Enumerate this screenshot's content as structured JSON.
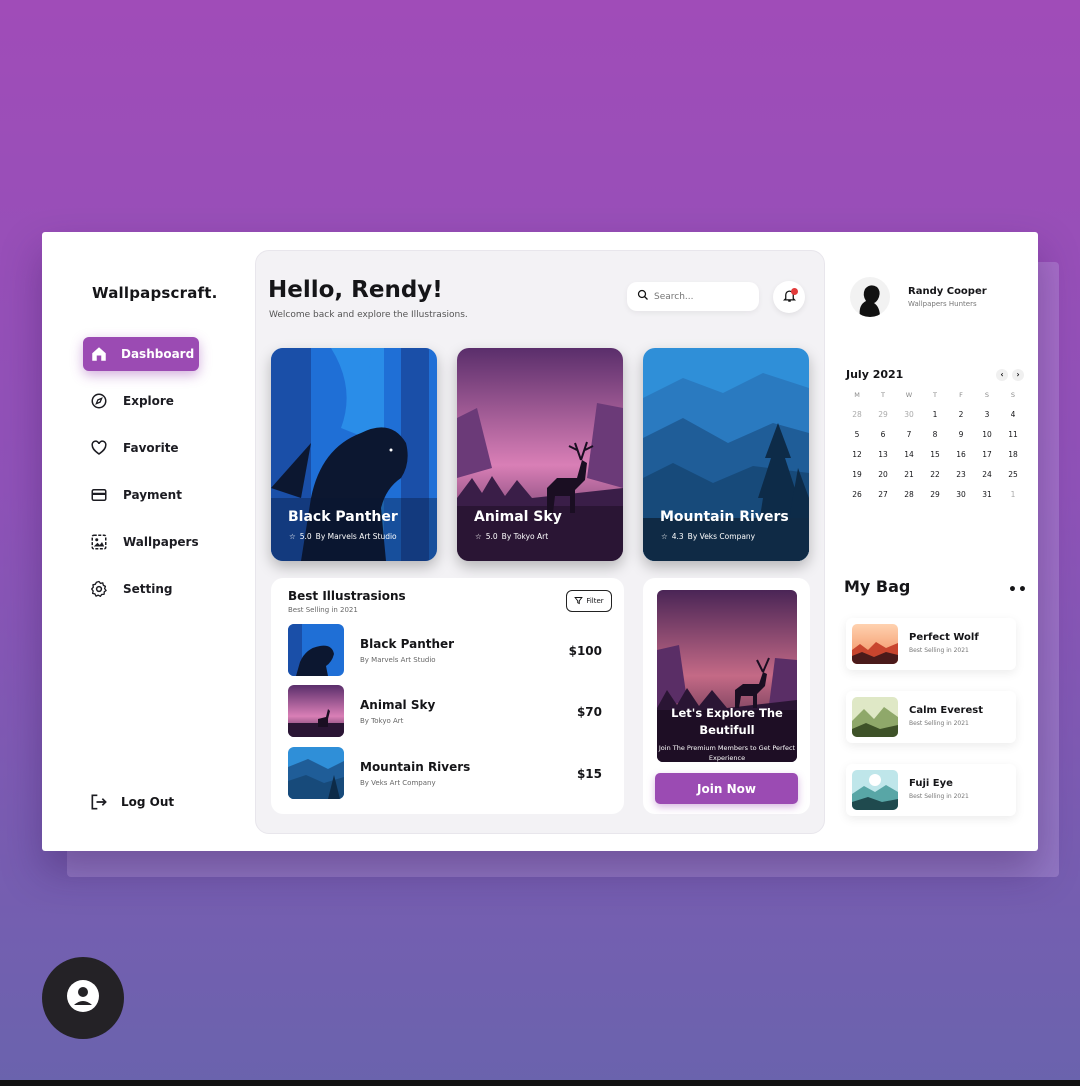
{
  "brand": "Wallpapscraft.",
  "nav": {
    "items": [
      {
        "label": "Dashboard",
        "icon": "home-icon",
        "active": true
      },
      {
        "label": "Explore",
        "icon": "compass-icon"
      },
      {
        "label": "Favorite",
        "icon": "heart-icon"
      },
      {
        "label": "Payment",
        "icon": "card-icon"
      },
      {
        "label": "Wallpapers",
        "icon": "image-icon"
      },
      {
        "label": "Setting",
        "icon": "gear-icon"
      }
    ],
    "logout": "Log Out"
  },
  "header": {
    "greeting": "Hello, Rendy!",
    "subtitle": "Welcome back and explore the Illustrasions.",
    "search_placeholder": "Search..."
  },
  "featured": [
    {
      "title": "Black Panther",
      "rating": "5.0",
      "by": "By Marvels Art Studio",
      "palette": "blue"
    },
    {
      "title": "Animal Sky",
      "rating": "5.0",
      "by": "By Tokyo Art",
      "palette": "purple"
    },
    {
      "title": "Mountain Rivers",
      "rating": "4.3",
      "by": "By Veks Company",
      "palette": "teal"
    }
  ],
  "best": {
    "title": "Best Illustrasions",
    "subtitle": "Best Selling in 2021",
    "filter": "Filter",
    "items": [
      {
        "name": "Black Panther",
        "by": "By Marvels Art Studio",
        "price": "$100"
      },
      {
        "name": "Animal Sky",
        "by": "By Tokyo Art",
        "price": "$70"
      },
      {
        "name": "Mountain Rivers",
        "by": "By Veks Art Company",
        "price": "$15"
      }
    ]
  },
  "promo": {
    "title": "Let's Explore The Beutifull",
    "subtitle": "Join The Premium Members to Get Perfect Experience",
    "button": "Join Now"
  },
  "profile": {
    "name": "Randy Cooper",
    "role": "Wallpapers Hunters"
  },
  "calendar": {
    "month": "July 2021",
    "prev": "‹",
    "next": "›",
    "day_names": [
      "M",
      "T",
      "W",
      "T",
      "F",
      "S",
      "S"
    ],
    "weeks": [
      [
        "28",
        "29",
        "30",
        "1",
        "2",
        "3",
        "4"
      ],
      [
        "5",
        "6",
        "7",
        "8",
        "9",
        "10",
        "11"
      ],
      [
        "12",
        "13",
        "14",
        "15",
        "16",
        "17",
        "18"
      ],
      [
        "19",
        "20",
        "21",
        "22",
        "23",
        "24",
        "25"
      ],
      [
        "26",
        "27",
        "28",
        "29",
        "30",
        "31",
        "1"
      ]
    ]
  },
  "bag": {
    "title": "My Bag",
    "more": "••",
    "items": [
      {
        "name": "Perfect Wolf",
        "sub": "Best Selling in 2021"
      },
      {
        "name": "Calm Everest",
        "sub": "Best Selling in 2021"
      },
      {
        "name": "Fuji Eye",
        "sub": "Best Selling in 2021"
      }
    ]
  },
  "colors": {
    "accent": "#9b4bb3",
    "background_top": "#a04cb8",
    "background_bottom": "#6a63ad",
    "notification": "#e23b3b"
  }
}
